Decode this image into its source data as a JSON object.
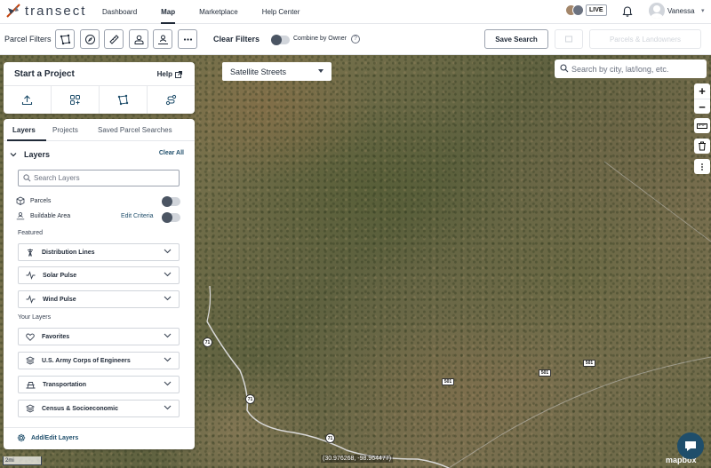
{
  "nav": {
    "brand": "transect",
    "links": [
      "Dashboard",
      "Map",
      "Marketplace",
      "Help Center"
    ],
    "active": "Map",
    "live_badge": "LIVE",
    "user_name": "Vanessa"
  },
  "filters": {
    "label": "Parcel Filters",
    "clear_label": "Clear Filters",
    "combine_label": "Combine by Owner",
    "save_search": "Save Search",
    "parcels_landowners": "Parcels & Landowners"
  },
  "map": {
    "style": "Satellite Streets",
    "search_placeholder": "Search by city, lat/long, etc.",
    "coordinates": "(30.976268, -98.964477)",
    "scale_label": "2mi",
    "attribution": "mapbox",
    "shields": [
      "71",
      "71",
      "71",
      "501",
      "501",
      "501"
    ]
  },
  "project": {
    "title": "Start a Project",
    "help": "Help"
  },
  "layers": {
    "tabs": [
      "Layers",
      "Projects",
      "Saved Parcel Searches"
    ],
    "section_title": "Layers",
    "clear_all": "Clear All",
    "search_placeholder": "Search Layers",
    "toggles": [
      {
        "label": "Parcels",
        "icon": "cube-icon"
      },
      {
        "label": "Buildable Area",
        "icon": "user-area-icon",
        "link": "Edit Criteria"
      }
    ],
    "featured_label": "Featured",
    "featured": [
      "Distribution Lines",
      "Solar Pulse",
      "Wind Pulse"
    ],
    "your_layers_label": "Your Layers",
    "your_layers": [
      "Favorites",
      "U.S. Army Corps of Engineers",
      "Transportation",
      "Census & Socioeconomic"
    ],
    "add_edit": "Add/Edit Layers"
  }
}
